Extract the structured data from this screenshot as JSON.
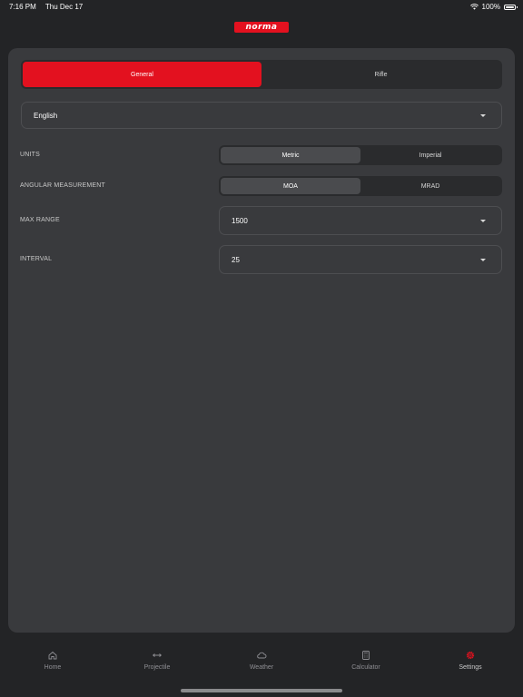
{
  "status": {
    "time": "7:16 PM",
    "date": "Thu Dec 17",
    "battery": "100%"
  },
  "logo": "norma",
  "tabs_top": [
    {
      "label": "General"
    },
    {
      "label": "Rifle"
    }
  ],
  "language": {
    "value": "English"
  },
  "settings": {
    "units": {
      "label": "UNITS",
      "options": [
        "Metric",
        "Imperial"
      ]
    },
    "angular": {
      "label": "ANGULAR MEASUREMENT",
      "options": [
        "MOA",
        "MRAD"
      ]
    },
    "max_range": {
      "label": "MAX RANGE",
      "value": "1500"
    },
    "interval": {
      "label": "INTERVAL",
      "value": "25"
    }
  },
  "tabbar": [
    {
      "label": "Home",
      "icon": "home-icon"
    },
    {
      "label": "Projectile",
      "icon": "arrows-horizontal-icon"
    },
    {
      "label": "Weather",
      "icon": "cloud-icon"
    },
    {
      "label": "Calculator",
      "icon": "calculator-icon"
    },
    {
      "label": "Settings",
      "icon": "gear-icon"
    }
  ],
  "colors": {
    "accent": "#e3111f",
    "panel": "#393a3d",
    "background": "#232426"
  }
}
